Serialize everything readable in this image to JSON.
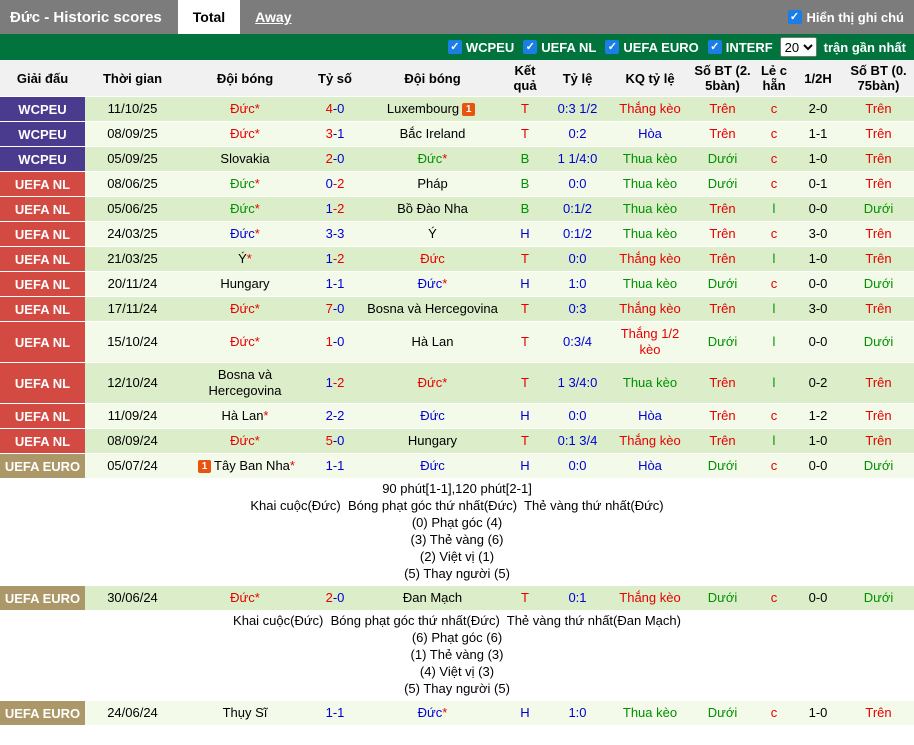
{
  "header": {
    "title": "Đức - Historic scores",
    "tabs": [
      "Total",
      "Away"
    ],
    "show_notes_label": "Hiển thị ghi chú"
  },
  "filters": {
    "leagues": [
      "WCPEU",
      "UEFA NL",
      "UEFA EURO",
      "INTERF"
    ],
    "recent_count": "20",
    "recent_label": "trận gần nhất"
  },
  "icons": {
    "checkbox_check": "✓",
    "red_card_icon": "1"
  },
  "palette": {
    "topbar_gray": "#7c7c7c",
    "accent_green_bar": "#00743c",
    "checkbox_blue": "#1a7ee6",
    "card_icon_orange": "#e8540e",
    "row_green": "#dbeec9",
    "row_pale": "#f3fae9",
    "league_colors": {
      "WCPEU": "#4a3b8f",
      "UEFA NL": "#d24a42",
      "UEFA EURO": "#ab9768"
    },
    "text_colors": {
      "red": "#e60000",
      "blue": "#0000d5",
      "green": "#009000",
      "black": "#000000"
    }
  },
  "table": {
    "columns": [
      "Giải đấu",
      "Thời gian",
      "Đội bóng",
      "Tỷ số",
      "Đội bóng",
      "Kết\nquả",
      "Tỷ lệ",
      "KQ tỷ lệ",
      "Số BT (2.\n5bàn)",
      "Lẻ c\nhẵn",
      "1/2H",
      "Số BT (0.\n75bàn)"
    ],
    "rows": [
      {
        "league": "WCPEU",
        "date": "11/10/25",
        "home": {
          "name": "Đức",
          "star": true,
          "color": "red",
          "card": false
        },
        "score": {
          "home": "4",
          "away": "0",
          "home_color": "red",
          "away_color": "blue"
        },
        "away": {
          "name": "Luxembourg",
          "star": false,
          "color": "black",
          "card": true
        },
        "result": {
          "text": "T",
          "color": "red"
        },
        "odds": "0:3 1/2",
        "kq": {
          "text": "Thắng kèo",
          "color": "red"
        },
        "ou25": {
          "text": "Trên",
          "color": "red"
        },
        "oe": {
          "text": "c",
          "color": "red"
        },
        "half": "2-0",
        "ou075": {
          "text": "Trên",
          "color": "red"
        },
        "note": null
      },
      {
        "league": "WCPEU",
        "date": "08/09/25",
        "home": {
          "name": "Đức",
          "star": true,
          "color": "red",
          "card": false
        },
        "score": {
          "home": "3",
          "away": "1",
          "home_color": "red",
          "away_color": "blue"
        },
        "away": {
          "name": "Bắc Ireland",
          "star": false,
          "color": "black",
          "card": false
        },
        "result": {
          "text": "T",
          "color": "red"
        },
        "odds": "0:2",
        "kq": {
          "text": "Hòa",
          "color": "blue"
        },
        "ou25": {
          "text": "Trên",
          "color": "red"
        },
        "oe": {
          "text": "c",
          "color": "red"
        },
        "half": "1-1",
        "ou075": {
          "text": "Trên",
          "color": "red"
        },
        "note": null
      },
      {
        "league": "WCPEU",
        "date": "05/09/25",
        "home": {
          "name": "Slovakia",
          "star": false,
          "color": "black",
          "card": false
        },
        "score": {
          "home": "2",
          "away": "0",
          "home_color": "red",
          "away_color": "blue"
        },
        "away": {
          "name": "Đức",
          "star": true,
          "color": "green",
          "card": false
        },
        "result": {
          "text": "B",
          "color": "green"
        },
        "odds": "1 1/4:0",
        "kq": {
          "text": "Thua kèo",
          "color": "green"
        },
        "ou25": {
          "text": "Dưới",
          "color": "green"
        },
        "oe": {
          "text": "c",
          "color": "red"
        },
        "half": "1-0",
        "ou075": {
          "text": "Trên",
          "color": "red"
        },
        "note": null
      },
      {
        "league": "UEFA NL",
        "date": "08/06/25",
        "home": {
          "name": "Đức",
          "star": true,
          "color": "green",
          "card": false
        },
        "score": {
          "home": "0",
          "away": "2",
          "home_color": "blue",
          "away_color": "red"
        },
        "away": {
          "name": "Pháp",
          "star": false,
          "color": "black",
          "card": false
        },
        "result": {
          "text": "B",
          "color": "green"
        },
        "odds": "0:0",
        "kq": {
          "text": "Thua kèo",
          "color": "green"
        },
        "ou25": {
          "text": "Dưới",
          "color": "green"
        },
        "oe": {
          "text": "c",
          "color": "red"
        },
        "half": "0-1",
        "ou075": {
          "text": "Trên",
          "color": "red"
        },
        "note": null
      },
      {
        "league": "UEFA NL",
        "date": "05/06/25",
        "home": {
          "name": "Đức",
          "star": true,
          "color": "green",
          "card": false
        },
        "score": {
          "home": "1",
          "away": "2",
          "home_color": "blue",
          "away_color": "red"
        },
        "away": {
          "name": "Bồ Đào Nha",
          "star": false,
          "color": "black",
          "card": false
        },
        "result": {
          "text": "B",
          "color": "green"
        },
        "odds": "0:1/2",
        "kq": {
          "text": "Thua kèo",
          "color": "green"
        },
        "ou25": {
          "text": "Trên",
          "color": "red"
        },
        "oe": {
          "text": "l",
          "color": "green"
        },
        "half": "0-0",
        "ou075": {
          "text": "Dưới",
          "color": "green"
        },
        "note": null
      },
      {
        "league": "UEFA NL",
        "date": "24/03/25",
        "home": {
          "name": "Đức",
          "star": true,
          "color": "blue",
          "card": false
        },
        "score": {
          "home": "3",
          "away": "3",
          "home_color": "blue",
          "away_color": "blue"
        },
        "away": {
          "name": "Ý",
          "star": false,
          "color": "black",
          "card": false
        },
        "result": {
          "text": "H",
          "color": "blue"
        },
        "odds": "0:1/2",
        "kq": {
          "text": "Thua kèo",
          "color": "green"
        },
        "ou25": {
          "text": "Trên",
          "color": "red"
        },
        "oe": {
          "text": "c",
          "color": "red"
        },
        "half": "3-0",
        "ou075": {
          "text": "Trên",
          "color": "red"
        },
        "note": null
      },
      {
        "league": "UEFA NL",
        "date": "21/03/25",
        "home": {
          "name": "Ý",
          "star": true,
          "color": "black",
          "card": false
        },
        "score": {
          "home": "1",
          "away": "2",
          "home_color": "blue",
          "away_color": "red"
        },
        "away": {
          "name": "Đức",
          "star": false,
          "color": "red",
          "card": false
        },
        "result": {
          "text": "T",
          "color": "red"
        },
        "odds": "0:0",
        "kq": {
          "text": "Thắng kèo",
          "color": "red"
        },
        "ou25": {
          "text": "Trên",
          "color": "red"
        },
        "oe": {
          "text": "l",
          "color": "green"
        },
        "half": "1-0",
        "ou075": {
          "text": "Trên",
          "color": "red"
        },
        "note": null
      },
      {
        "league": "UEFA NL",
        "date": "20/11/24",
        "home": {
          "name": "Hungary",
          "star": false,
          "color": "black",
          "card": false
        },
        "score": {
          "home": "1",
          "away": "1",
          "home_color": "blue",
          "away_color": "blue"
        },
        "away": {
          "name": "Đức",
          "star": true,
          "color": "blue",
          "card": false
        },
        "result": {
          "text": "H",
          "color": "blue"
        },
        "odds": "1:0",
        "kq": {
          "text": "Thua kèo",
          "color": "green"
        },
        "ou25": {
          "text": "Dưới",
          "color": "green"
        },
        "oe": {
          "text": "c",
          "color": "red"
        },
        "half": "0-0",
        "ou075": {
          "text": "Dưới",
          "color": "green"
        },
        "note": null
      },
      {
        "league": "UEFA NL",
        "date": "17/11/24",
        "home": {
          "name": "Đức",
          "star": true,
          "color": "red",
          "card": false
        },
        "score": {
          "home": "7",
          "away": "0",
          "home_color": "red",
          "away_color": "blue"
        },
        "away": {
          "name": "Bosna và Hercegovina",
          "star": false,
          "color": "black",
          "card": false
        },
        "result": {
          "text": "T",
          "color": "red"
        },
        "odds": "0:3",
        "kq": {
          "text": "Thắng kèo",
          "color": "red"
        },
        "ou25": {
          "text": "Trên",
          "color": "red"
        },
        "oe": {
          "text": "l",
          "color": "green"
        },
        "half": "3-0",
        "ou075": {
          "text": "Trên",
          "color": "red"
        },
        "note": null
      },
      {
        "league": "UEFA NL",
        "date": "15/10/24",
        "home": {
          "name": "Đức",
          "star": true,
          "color": "red",
          "card": false
        },
        "score": {
          "home": "1",
          "away": "0",
          "home_color": "red",
          "away_color": "blue"
        },
        "away": {
          "name": "Hà Lan",
          "star": false,
          "color": "black",
          "card": false
        },
        "result": {
          "text": "T",
          "color": "red"
        },
        "odds": "0:3/4",
        "kq": {
          "text": "Thắng 1/2 kèo",
          "color": "red"
        },
        "ou25": {
          "text": "Dưới",
          "color": "green"
        },
        "oe": {
          "text": "l",
          "color": "green"
        },
        "half": "0-0",
        "ou075": {
          "text": "Dưới",
          "color": "green"
        },
        "note": null
      },
      {
        "league": "UEFA NL",
        "date": "12/10/24",
        "home": {
          "name": "Bosna và Hercegovina",
          "star": false,
          "color": "black",
          "card": false
        },
        "score": {
          "home": "1",
          "away": "2",
          "home_color": "blue",
          "away_color": "red"
        },
        "away": {
          "name": "Đức",
          "star": true,
          "color": "red",
          "card": false
        },
        "result": {
          "text": "T",
          "color": "red"
        },
        "odds": "1 3/4:0",
        "kq": {
          "text": "Thua kèo",
          "color": "green"
        },
        "ou25": {
          "text": "Trên",
          "color": "red"
        },
        "oe": {
          "text": "l",
          "color": "green"
        },
        "half": "0-2",
        "ou075": {
          "text": "Trên",
          "color": "red"
        },
        "note": null
      },
      {
        "league": "UEFA NL",
        "date": "11/09/24",
        "home": {
          "name": "Hà Lan",
          "star": true,
          "color": "black",
          "card": false
        },
        "score": {
          "home": "2",
          "away": "2",
          "home_color": "blue",
          "away_color": "blue"
        },
        "away": {
          "name": "Đức",
          "star": false,
          "color": "blue",
          "card": false
        },
        "result": {
          "text": "H",
          "color": "blue"
        },
        "odds": "0:0",
        "kq": {
          "text": "Hòa",
          "color": "blue"
        },
        "ou25": {
          "text": "Trên",
          "color": "red"
        },
        "oe": {
          "text": "c",
          "color": "red"
        },
        "half": "1-2",
        "ou075": {
          "text": "Trên",
          "color": "red"
        },
        "note": null
      },
      {
        "league": "UEFA NL",
        "date": "08/09/24",
        "home": {
          "name": "Đức",
          "star": true,
          "color": "red",
          "card": false
        },
        "score": {
          "home": "5",
          "away": "0",
          "home_color": "red",
          "away_color": "blue"
        },
        "away": {
          "name": "Hungary",
          "star": false,
          "color": "black",
          "card": false
        },
        "result": {
          "text": "T",
          "color": "red"
        },
        "odds": "0:1 3/4",
        "kq": {
          "text": "Thắng kèo",
          "color": "red"
        },
        "ou25": {
          "text": "Trên",
          "color": "red"
        },
        "oe": {
          "text": "l",
          "color": "green"
        },
        "half": "1-0",
        "ou075": {
          "text": "Trên",
          "color": "red"
        },
        "note": null
      },
      {
        "league": "UEFA EURO",
        "date": "05/07/24",
        "home": {
          "name": "Tây Ban Nha",
          "star": true,
          "color": "black",
          "card": true
        },
        "score": {
          "home": "1",
          "away": "1",
          "home_color": "blue",
          "away_color": "blue"
        },
        "away": {
          "name": "Đức",
          "star": false,
          "color": "blue",
          "card": false
        },
        "result": {
          "text": "H",
          "color": "blue"
        },
        "odds": "0:0",
        "kq": {
          "text": "Hòa",
          "color": "blue"
        },
        "ou25": {
          "text": "Dưới",
          "color": "green"
        },
        "oe": {
          "text": "c",
          "color": "red"
        },
        "half": "0-0",
        "ou075": {
          "text": "Dưới",
          "color": "green"
        },
        "note": {
          "lines": [
            "90 phút[1-1],120 phút[2-1]",
            "Khai cuộc(Đức)  Bóng phạt góc thứ nhất(Đức)  Thẻ vàng thứ nhất(Đức)",
            "(0) Phạt góc (4)",
            "(3) Thẻ vàng (6)",
            "(2) Việt vị (1)",
            "(5) Thay người (5)"
          ]
        }
      },
      {
        "league": "UEFA EURO",
        "date": "30/06/24",
        "home": {
          "name": "Đức",
          "star": true,
          "color": "red",
          "card": false
        },
        "score": {
          "home": "2",
          "away": "0",
          "home_color": "red",
          "away_color": "blue"
        },
        "away": {
          "name": "Đan Mạch",
          "star": false,
          "color": "black",
          "card": false
        },
        "result": {
          "text": "T",
          "color": "red"
        },
        "odds": "0:1",
        "kq": {
          "text": "Thắng kèo",
          "color": "red"
        },
        "ou25": {
          "text": "Dưới",
          "color": "green"
        },
        "oe": {
          "text": "c",
          "color": "red"
        },
        "half": "0-0",
        "ou075": {
          "text": "Dưới",
          "color": "green"
        },
        "note": {
          "lines": [
            "Khai cuộc(Đức)  Bóng phạt góc thứ nhất(Đức)  Thẻ vàng thứ nhất(Đan Mạch)",
            "(6) Phạt góc (6)",
            "(1) Thẻ vàng (3)",
            "(4) Việt vị (3)",
            "(5) Thay người (5)"
          ]
        }
      },
      {
        "league": "UEFA EURO",
        "date": "24/06/24",
        "home": {
          "name": "Thụy Sĩ",
          "star": false,
          "color": "black",
          "card": false
        },
        "score": {
          "home": "1",
          "away": "1",
          "home_color": "blue",
          "away_color": "blue"
        },
        "away": {
          "name": "Đức",
          "star": true,
          "color": "blue",
          "card": false
        },
        "result": {
          "text": "H",
          "color": "blue"
        },
        "odds": "1:0",
        "kq": {
          "text": "Thua kèo",
          "color": "green"
        },
        "ou25": {
          "text": "Dưới",
          "color": "green"
        },
        "oe": {
          "text": "c",
          "color": "red"
        },
        "half": "1-0",
        "ou075": {
          "text": "Trên",
          "color": "red"
        },
        "note": null
      }
    ]
  }
}
